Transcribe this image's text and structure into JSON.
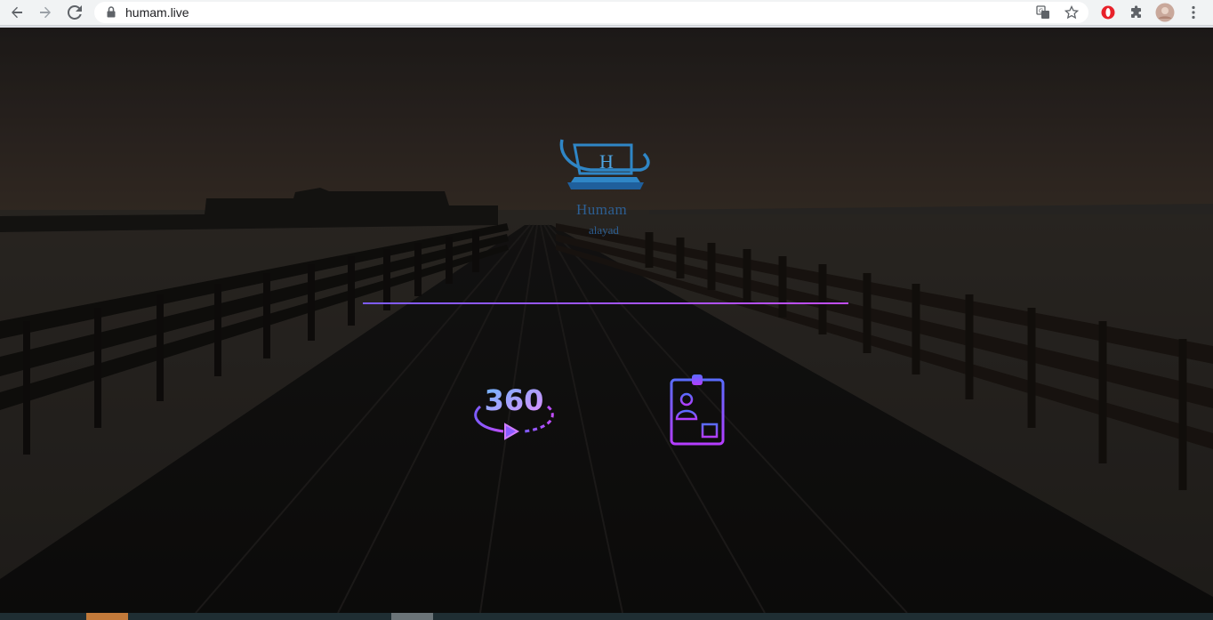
{
  "browser": {
    "url": "humam.live",
    "back_icon": "arrow-left-icon",
    "forward_icon": "arrow-right-icon",
    "reload_icon": "reload-icon",
    "lock_icon": "lock-icon",
    "translate_icon": "translate-icon",
    "bookmark_icon": "star-icon",
    "extension_icons": [
      "opera-icon",
      "puzzle-icon"
    ],
    "menu_icon": "kebab-menu-icon"
  },
  "page": {
    "logo": {
      "letter": "H",
      "name": "Humam",
      "subtitle": "alayad"
    },
    "accent_colors": [
      "#7d5cff",
      "#c34dff"
    ],
    "links": [
      {
        "name": "360-view",
        "icon": "360-icon",
        "label": "360"
      },
      {
        "name": "profile-card",
        "icon": "id-card-icon"
      }
    ]
  }
}
